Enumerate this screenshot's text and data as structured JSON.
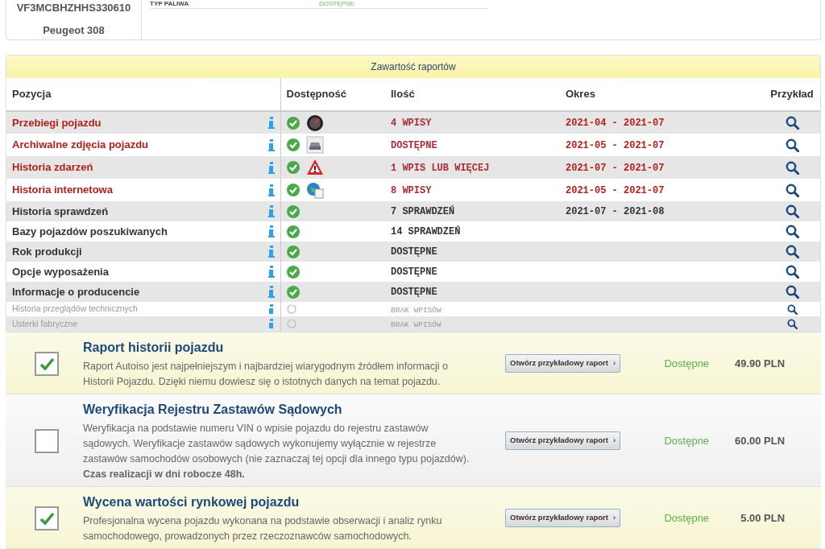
{
  "vehicle": {
    "vin": "VF3MCBHZHHS330610",
    "model": "Peugeot 308",
    "fields": [
      {
        "label": "TYP PALIWA",
        "value": "DOSTĘPNE"
      }
    ]
  },
  "reports": {
    "title": "Zawartość raportów",
    "columns": [
      "Pozycja",
      "Dostępność",
      "Ilość",
      "Okres",
      "Przykład"
    ],
    "rows": [
      {
        "name": "Przebiegi pojazdu",
        "kind": "found",
        "available": true,
        "count": "4 WPISY",
        "period": "2021-04 - 2021-07"
      },
      {
        "name": "Archiwalne zdjęcia pojazdu",
        "kind": "found",
        "available": true,
        "count": "DOSTĘPNE",
        "period": "2021-05 - 2021-07"
      },
      {
        "name": "Historia zdarzeń",
        "kind": "found",
        "available": true,
        "count": "1 WPIS LUB WIĘCEJ",
        "period": "2021-07 - 2021-07"
      },
      {
        "name": "Historia internetowa",
        "kind": "found",
        "available": true,
        "count": "8 WPISY",
        "period": "2021-05 - 2021-07"
      },
      {
        "name": "Historia sprawdzeń",
        "kind": "plain",
        "available": true,
        "count": "7 SPRAWDZEŃ",
        "period": "2021-07 - 2021-08"
      },
      {
        "name": "Bazy pojazdów poszukiwanych",
        "kind": "plain",
        "available": true,
        "count": "14 SPRAWDZEŃ"
      },
      {
        "name": "Rok produkcji",
        "kind": "plain",
        "available": true,
        "count": "DOSTĘPNE"
      },
      {
        "name": "Opcje wyposażenia",
        "kind": "plain",
        "available": true,
        "count": "DOSTĘPNE"
      },
      {
        "name": "Informacje o producencie",
        "kind": "plain",
        "available": true,
        "count": "DOSTĘPNE"
      },
      {
        "name": "Historia przeglądów technicznych",
        "kind": "empty",
        "available": false,
        "count": "BRAK WPISÓW"
      },
      {
        "name": "Usterki fabryczne",
        "kind": "empty",
        "available": false,
        "count": "BRAK WPISÓW"
      }
    ]
  },
  "products": [
    {
      "title": "Raport historii pojazdu",
      "checked": true,
      "description": "Raport Autoiso jest najpełniejszym i najbardziej wiarygodnym źródłem informacji o Historii Pojazdu. Dzięki niemu dowiesz się o istotnych danych na temat pojazdu.",
      "button": "Otwórz przykładowy raport",
      "button_icon": "›",
      "status": "Dostępne",
      "price": "49.90 PLN"
    },
    {
      "title": "Weryfikacja Rejestru Zastawów Sądowych",
      "checked": false,
      "description": "Weryfikacja na podstawie numeru VIN o wpisie pojazdu do rejestru zastawów sądowych. Weryfikacje zastawów sądowych wykonujemy wyłącznie w rejestrze zastawów samochodów osobowych (nie zaznaczaj tej opcji dla innego typu pojazdów). **Czas realizacji w dni robocze 48h.**",
      "button": "Otwórz przykładowy raport",
      "button_icon": "›",
      "status": "Dostępne",
      "price": "60.00 PLN"
    },
    {
      "title": "Wycena wartości rynkowej pojazdu",
      "checked": true,
      "description": "Profesjonalna wycena pojazdu wykonana na podstawie obserwacji i analiz rynku samochodowego, prowadzonych przez rzeczoznawców samochodowych.",
      "button": "Otwórz przykładowy raport",
      "button_icon": "›",
      "status": "Dostępne",
      "price": "5.00 PLN"
    }
  ]
}
